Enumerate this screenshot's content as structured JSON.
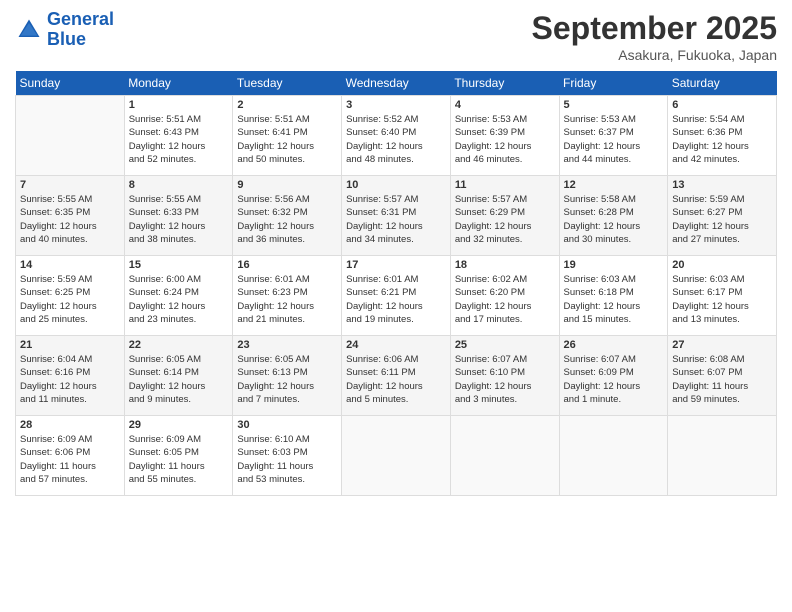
{
  "header": {
    "logo_line1": "General",
    "logo_line2": "Blue",
    "month": "September 2025",
    "location": "Asakura, Fukuoka, Japan"
  },
  "days_of_week": [
    "Sunday",
    "Monday",
    "Tuesday",
    "Wednesday",
    "Thursday",
    "Friday",
    "Saturday"
  ],
  "weeks": [
    [
      {
        "day": "",
        "info": ""
      },
      {
        "day": "1",
        "info": "Sunrise: 5:51 AM\nSunset: 6:43 PM\nDaylight: 12 hours\nand 52 minutes."
      },
      {
        "day": "2",
        "info": "Sunrise: 5:51 AM\nSunset: 6:41 PM\nDaylight: 12 hours\nand 50 minutes."
      },
      {
        "day": "3",
        "info": "Sunrise: 5:52 AM\nSunset: 6:40 PM\nDaylight: 12 hours\nand 48 minutes."
      },
      {
        "day": "4",
        "info": "Sunrise: 5:53 AM\nSunset: 6:39 PM\nDaylight: 12 hours\nand 46 minutes."
      },
      {
        "day": "5",
        "info": "Sunrise: 5:53 AM\nSunset: 6:37 PM\nDaylight: 12 hours\nand 44 minutes."
      },
      {
        "day": "6",
        "info": "Sunrise: 5:54 AM\nSunset: 6:36 PM\nDaylight: 12 hours\nand 42 minutes."
      }
    ],
    [
      {
        "day": "7",
        "info": "Sunrise: 5:55 AM\nSunset: 6:35 PM\nDaylight: 12 hours\nand 40 minutes."
      },
      {
        "day": "8",
        "info": "Sunrise: 5:55 AM\nSunset: 6:33 PM\nDaylight: 12 hours\nand 38 minutes."
      },
      {
        "day": "9",
        "info": "Sunrise: 5:56 AM\nSunset: 6:32 PM\nDaylight: 12 hours\nand 36 minutes."
      },
      {
        "day": "10",
        "info": "Sunrise: 5:57 AM\nSunset: 6:31 PM\nDaylight: 12 hours\nand 34 minutes."
      },
      {
        "day": "11",
        "info": "Sunrise: 5:57 AM\nSunset: 6:29 PM\nDaylight: 12 hours\nand 32 minutes."
      },
      {
        "day": "12",
        "info": "Sunrise: 5:58 AM\nSunset: 6:28 PM\nDaylight: 12 hours\nand 30 minutes."
      },
      {
        "day": "13",
        "info": "Sunrise: 5:59 AM\nSunset: 6:27 PM\nDaylight: 12 hours\nand 27 minutes."
      }
    ],
    [
      {
        "day": "14",
        "info": "Sunrise: 5:59 AM\nSunset: 6:25 PM\nDaylight: 12 hours\nand 25 minutes."
      },
      {
        "day": "15",
        "info": "Sunrise: 6:00 AM\nSunset: 6:24 PM\nDaylight: 12 hours\nand 23 minutes."
      },
      {
        "day": "16",
        "info": "Sunrise: 6:01 AM\nSunset: 6:23 PM\nDaylight: 12 hours\nand 21 minutes."
      },
      {
        "day": "17",
        "info": "Sunrise: 6:01 AM\nSunset: 6:21 PM\nDaylight: 12 hours\nand 19 minutes."
      },
      {
        "day": "18",
        "info": "Sunrise: 6:02 AM\nSunset: 6:20 PM\nDaylight: 12 hours\nand 17 minutes."
      },
      {
        "day": "19",
        "info": "Sunrise: 6:03 AM\nSunset: 6:18 PM\nDaylight: 12 hours\nand 15 minutes."
      },
      {
        "day": "20",
        "info": "Sunrise: 6:03 AM\nSunset: 6:17 PM\nDaylight: 12 hours\nand 13 minutes."
      }
    ],
    [
      {
        "day": "21",
        "info": "Sunrise: 6:04 AM\nSunset: 6:16 PM\nDaylight: 12 hours\nand 11 minutes."
      },
      {
        "day": "22",
        "info": "Sunrise: 6:05 AM\nSunset: 6:14 PM\nDaylight: 12 hours\nand 9 minutes."
      },
      {
        "day": "23",
        "info": "Sunrise: 6:05 AM\nSunset: 6:13 PM\nDaylight: 12 hours\nand 7 minutes."
      },
      {
        "day": "24",
        "info": "Sunrise: 6:06 AM\nSunset: 6:11 PM\nDaylight: 12 hours\nand 5 minutes."
      },
      {
        "day": "25",
        "info": "Sunrise: 6:07 AM\nSunset: 6:10 PM\nDaylight: 12 hours\nand 3 minutes."
      },
      {
        "day": "26",
        "info": "Sunrise: 6:07 AM\nSunset: 6:09 PM\nDaylight: 12 hours\nand 1 minute."
      },
      {
        "day": "27",
        "info": "Sunrise: 6:08 AM\nSunset: 6:07 PM\nDaylight: 11 hours\nand 59 minutes."
      }
    ],
    [
      {
        "day": "28",
        "info": "Sunrise: 6:09 AM\nSunset: 6:06 PM\nDaylight: 11 hours\nand 57 minutes."
      },
      {
        "day": "29",
        "info": "Sunrise: 6:09 AM\nSunset: 6:05 PM\nDaylight: 11 hours\nand 55 minutes."
      },
      {
        "day": "30",
        "info": "Sunrise: 6:10 AM\nSunset: 6:03 PM\nDaylight: 11 hours\nand 53 minutes."
      },
      {
        "day": "",
        "info": ""
      },
      {
        "day": "",
        "info": ""
      },
      {
        "day": "",
        "info": ""
      },
      {
        "day": "",
        "info": ""
      }
    ]
  ]
}
